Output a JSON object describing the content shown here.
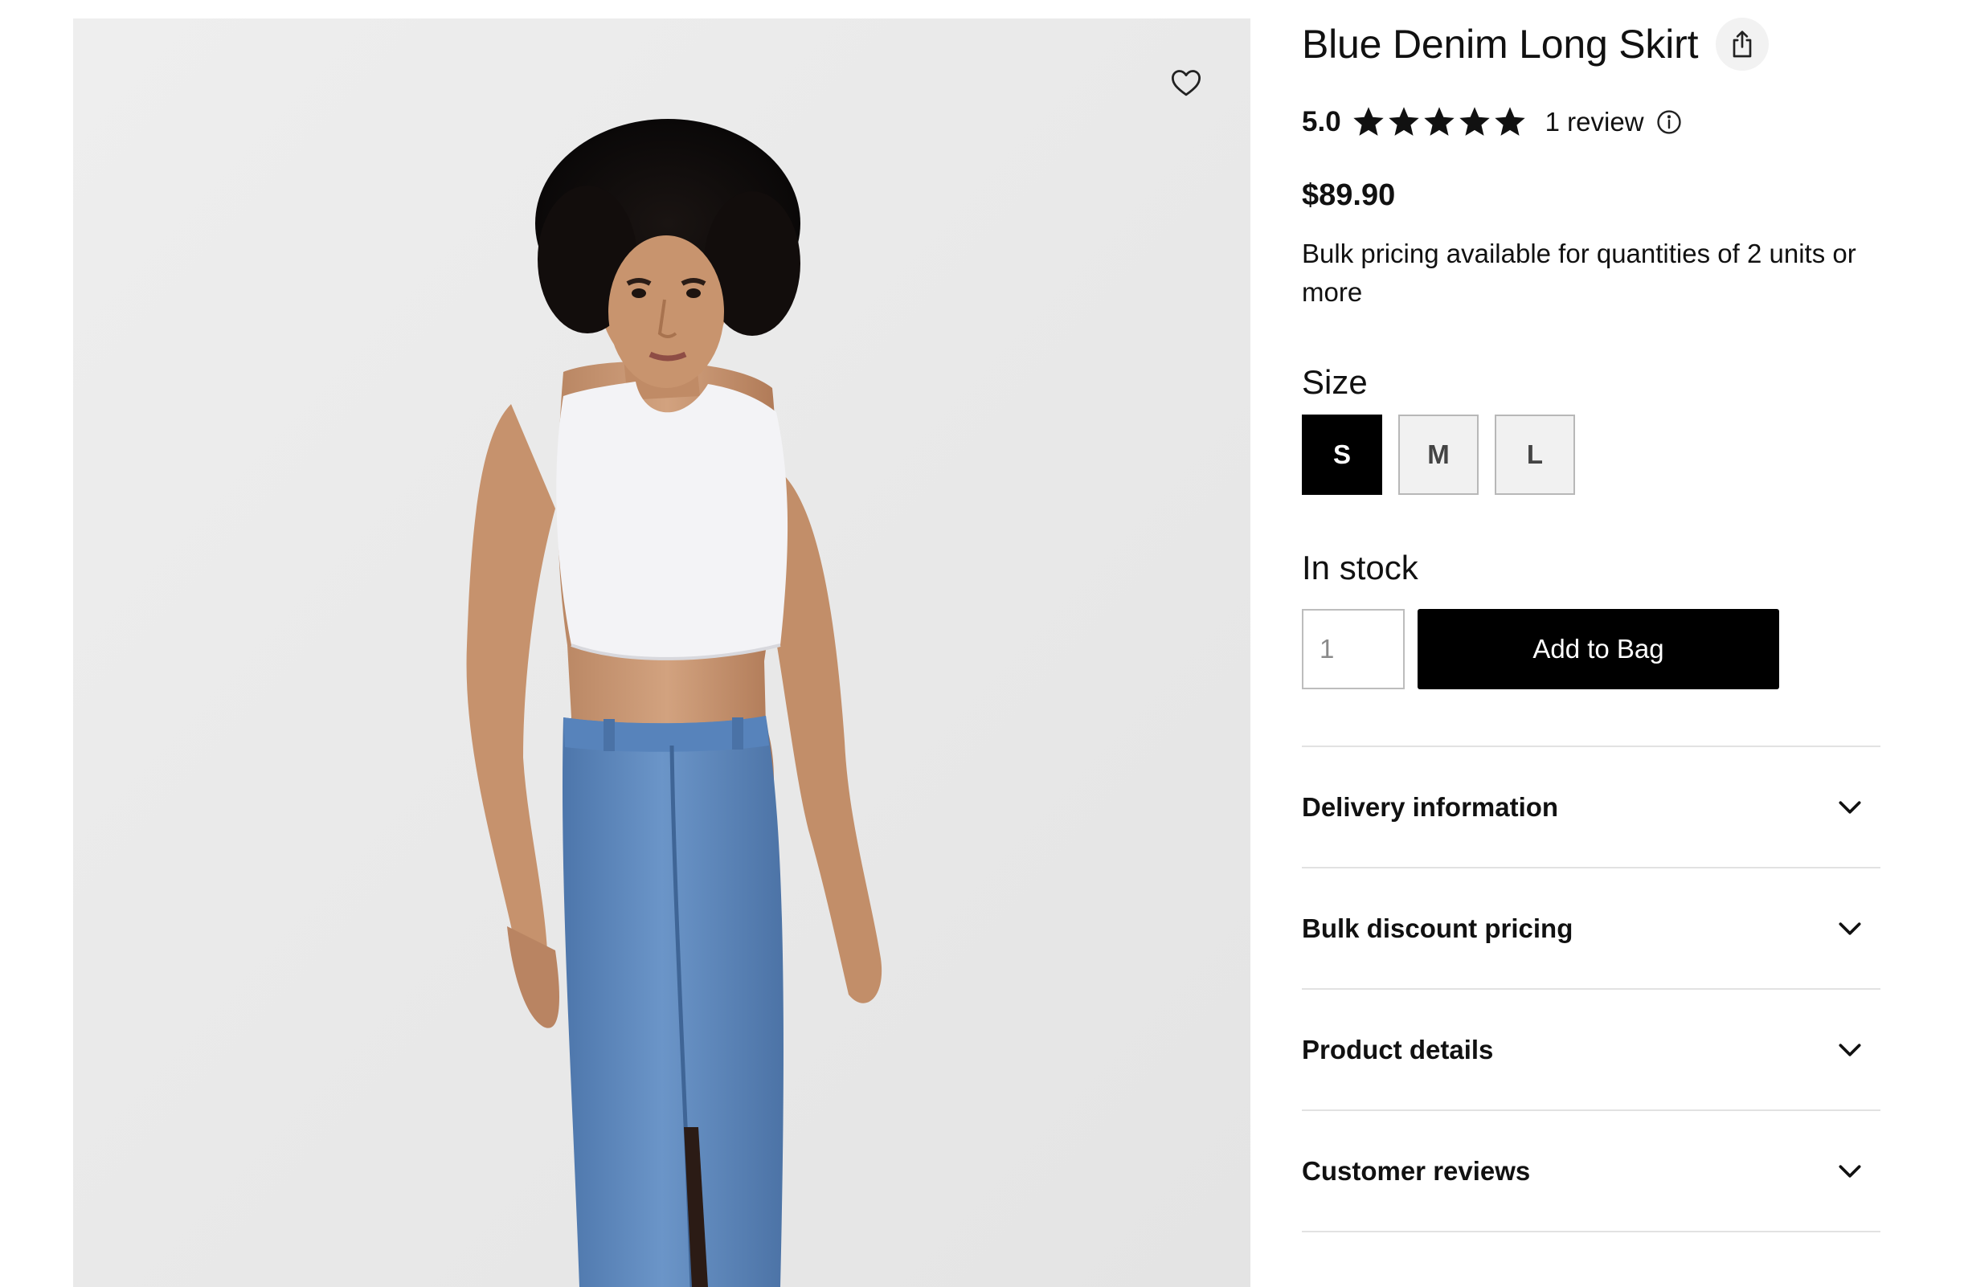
{
  "product": {
    "title": "Blue Denim Long Skirt",
    "rating_value": "5.0",
    "stars": 5,
    "review_count": "1 review",
    "price": "$89.90",
    "bulk_note": "Bulk pricing available for quantities of 2 units or more"
  },
  "size": {
    "label": "Size",
    "options": [
      "S",
      "M",
      "L"
    ],
    "selected": "S"
  },
  "stock": {
    "status": "In stock"
  },
  "purchase": {
    "quantity_placeholder": "1",
    "add_to_bag": "Add to Bag"
  },
  "accordion": [
    {
      "label": "Delivery information"
    },
    {
      "label": "Bulk discount pricing"
    },
    {
      "label": "Product details"
    },
    {
      "label": "Customer reviews"
    }
  ],
  "icons": {
    "wishlist": "heart-icon",
    "share": "share-icon",
    "star": "star-icon",
    "info": "info-icon",
    "expand": "chevron-down-icon"
  },
  "colors": {
    "primary_button": "#000000",
    "image_background": "#ececec",
    "skirt_denim": "#5b86bd"
  }
}
